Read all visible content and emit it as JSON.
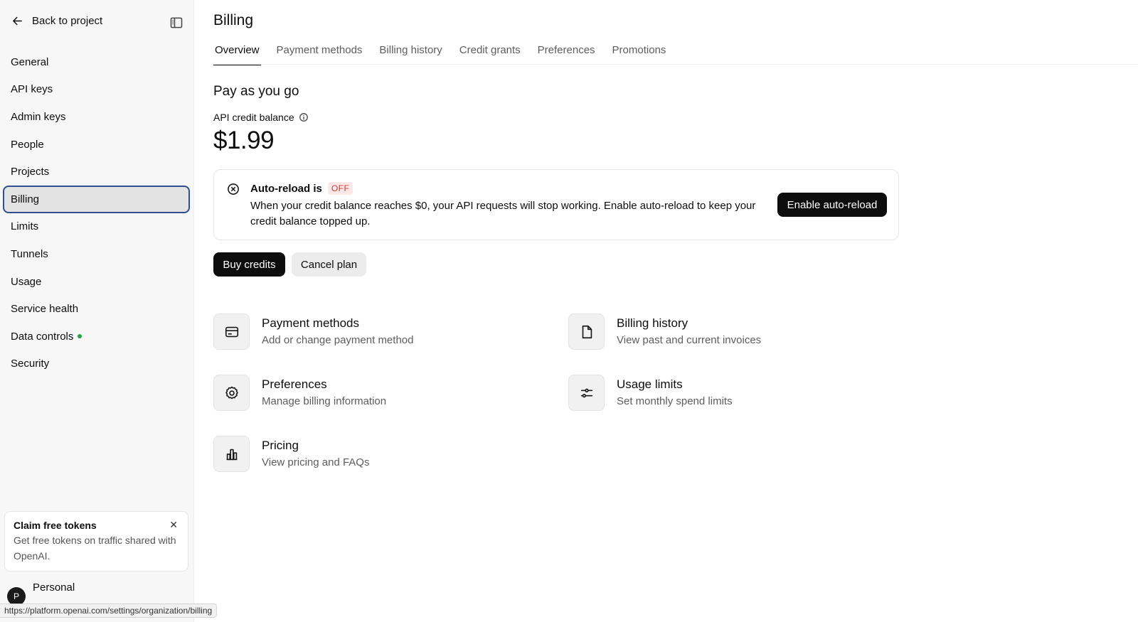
{
  "sidebar": {
    "back_label": "Back to project",
    "items": [
      {
        "label": "General"
      },
      {
        "label": "API keys"
      },
      {
        "label": "Admin keys"
      },
      {
        "label": "People"
      },
      {
        "label": "Projects"
      },
      {
        "label": "Billing"
      },
      {
        "label": "Limits"
      },
      {
        "label": "Tunnels"
      },
      {
        "label": "Usage"
      },
      {
        "label": "Service health"
      },
      {
        "label": "Data controls"
      },
      {
        "label": "Security"
      }
    ],
    "active_item": "Billing",
    "promo": {
      "title": "Claim free tokens",
      "text": "Get free tokens on traffic shared with OpenAI."
    },
    "org": {
      "avatar_initial": "P",
      "name": "Personal"
    }
  },
  "status_url": "https://platform.openai.com/settings/organization/billing",
  "main": {
    "title": "Billing",
    "tabs": [
      {
        "label": "Overview"
      },
      {
        "label": "Payment methods"
      },
      {
        "label": "Billing history"
      },
      {
        "label": "Credit grants"
      },
      {
        "label": "Preferences"
      },
      {
        "label": "Promotions"
      }
    ],
    "active_tab": "Overview",
    "section_title": "Pay as you go",
    "balance_label": "API credit balance",
    "balance": "$1.99",
    "alert": {
      "title": "Auto-reload is",
      "badge": "OFF",
      "text": "When your credit balance reaches $0, your API requests will stop working. Enable auto-reload to keep your credit balance topped up.",
      "button": "Enable auto-reload"
    },
    "buy_button": "Buy credits",
    "cancel_button": "Cancel plan",
    "cards": [
      {
        "title": "Payment methods",
        "desc": "Add or change payment method",
        "icon": "credit-card-icon"
      },
      {
        "title": "Billing history",
        "desc": "View past and current invoices",
        "icon": "document-icon"
      },
      {
        "title": "Preferences",
        "desc": "Manage billing information",
        "icon": "gear-icon"
      },
      {
        "title": "Usage limits",
        "desc": "Set monthly spend limits",
        "icon": "sliders-icon"
      },
      {
        "title": "Pricing",
        "desc": "View pricing and FAQs",
        "icon": "bar-chart-icon"
      }
    ]
  },
  "colors": {
    "accent_dark": "#0d0d0d",
    "badge_red": "#d23a3a",
    "active_outline": "#2f4f8f",
    "status_green": "#25a244"
  }
}
